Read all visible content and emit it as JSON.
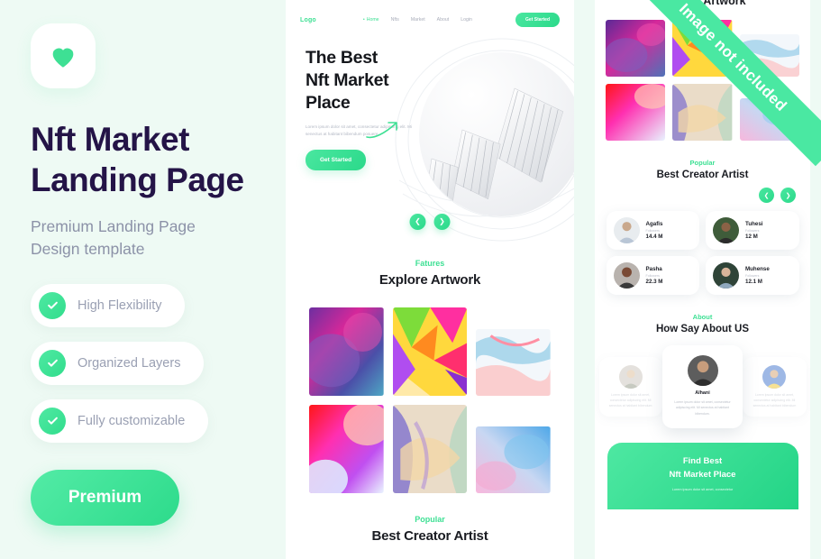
{
  "theme": {
    "background": "#eefaf4",
    "accent_green": "#3ee094",
    "title_purple": "#241447",
    "muted_text": "#8c92a8",
    "panel_white": "#ffffff"
  },
  "left": {
    "logo_icon": "heart-icon",
    "title_line1": "Nft Market",
    "title_line2": "Landing Page",
    "subtitle_line1": "Premium Landing Page",
    "subtitle_line2": "Design template",
    "features": [
      {
        "label": "High Flexibility",
        "icon": "check-icon"
      },
      {
        "label": "Organized Layers",
        "icon": "check-icon"
      },
      {
        "label": "Fully customizable",
        "icon": "check-icon"
      }
    ],
    "premium_button": "Premium"
  },
  "middle": {
    "nav": {
      "logo": "Logo",
      "links": [
        {
          "label": "Home",
          "active": true
        },
        {
          "label": "Nfts",
          "active": false
        },
        {
          "label": "Market",
          "active": false
        },
        {
          "label": "About",
          "active": false
        },
        {
          "label": "Login",
          "active": false
        }
      ],
      "cta": "Get Started"
    },
    "hero": {
      "title_line1": "The Best",
      "title_line2": "Nft Market",
      "title_line3": "Place",
      "arrow_icon": "curved-arrow-icon",
      "paragraph": "Lorem ipsum dolor sit amet, consectetur adipiscing elit. Mi senectus at habitant bibendum posuere.",
      "button": "Get Started",
      "visual": "3d-white-fan-sculpture",
      "prev_icon": "chevron-left-icon",
      "next_icon": "chevron-right-icon"
    },
    "features_section": {
      "label": "Fatures",
      "title": "Explore Artwork",
      "artworks": [
        {
          "name": "purple-blue-smoke-art"
        },
        {
          "name": "rainbow-geometric-prism-art"
        },
        {
          "name": "pink-blue-marble-art"
        },
        {
          "name": "red-magenta-gradient-art"
        },
        {
          "name": "pastel-feather-swirl-art"
        },
        {
          "name": "blue-pink-watercolor-art"
        }
      ]
    },
    "popular_section": {
      "label": "Popular",
      "title": "Best Creator Artist"
    }
  },
  "right": {
    "top_title": "Explore Artwork",
    "artworks": [
      {
        "name": "purple-magenta-smoke-art"
      },
      {
        "name": "rainbow-geometric-prism-art"
      },
      {
        "name": "blue-coral-marble-art"
      },
      {
        "name": "red-pink-gradient-art"
      },
      {
        "name": "pastel-swirl-art"
      },
      {
        "name": "blue-pink-watercolor-art"
      }
    ],
    "popular_section": {
      "label": "Popular",
      "title": "Best Creator Artist",
      "prev_icon": "chevron-left-icon",
      "next_icon": "chevron-right-icon",
      "followers_label": "Followers",
      "creators": [
        {
          "name": "Agafis",
          "followers": "14.4 M"
        },
        {
          "name": "Tuhesi",
          "followers": "12 M"
        },
        {
          "name": "Pasha",
          "followers": "22.3 M"
        },
        {
          "name": "Muhense",
          "followers": "12.1 M"
        }
      ]
    },
    "about_section": {
      "label": "About",
      "title": "How Say About US",
      "testimonials": [
        {
          "name": "",
          "text": "Lorem ipsum dolor sit amet, consectetur adipiscing elit. Mi senectus at habitant bibendum"
        },
        {
          "name": "Alhani",
          "text": "Lorem ipsum dolor sit amet, consectetur adipiscing elit. Mi senectus at habitant bibendum."
        },
        {
          "name": "",
          "text": "Lorem ipsum dolor sit amet, consectetur adipiscing elit. Mi senectus at habitant bibendum"
        }
      ]
    },
    "cta": {
      "line1": "Find Best",
      "line2": "Nft Market Place",
      "sub": "Lorem ipsum dolor sit amet, consectetur"
    }
  },
  "ribbon": {
    "text": "Image not included"
  }
}
